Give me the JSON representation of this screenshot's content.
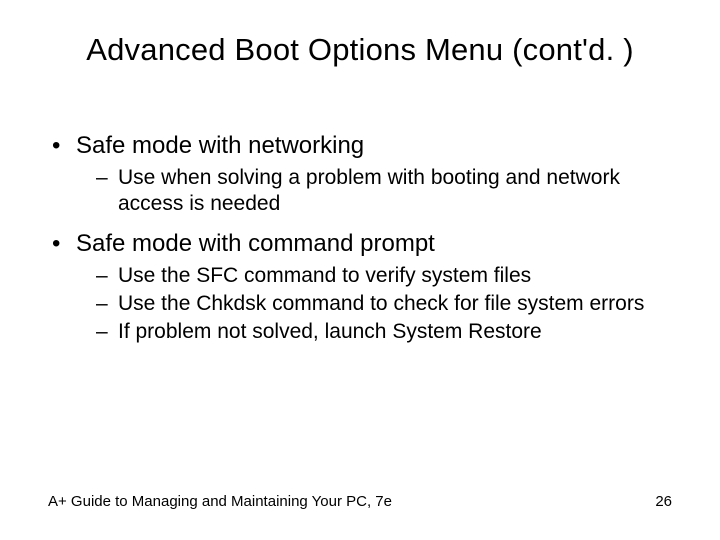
{
  "title": "Advanced Boot Options Menu (cont'd. )",
  "bullets": [
    {
      "text": "Safe mode with networking",
      "sub": [
        "Use when solving a problem with booting and network access is needed"
      ]
    },
    {
      "text": "Safe mode with command prompt",
      "sub": [
        "Use the SFC command to verify system files",
        "Use the Chkdsk command to check for file system errors",
        "If problem not solved, launch System Restore"
      ]
    }
  ],
  "footer": {
    "left": "A+ Guide to Managing and Maintaining Your PC, 7e",
    "page": "26"
  }
}
